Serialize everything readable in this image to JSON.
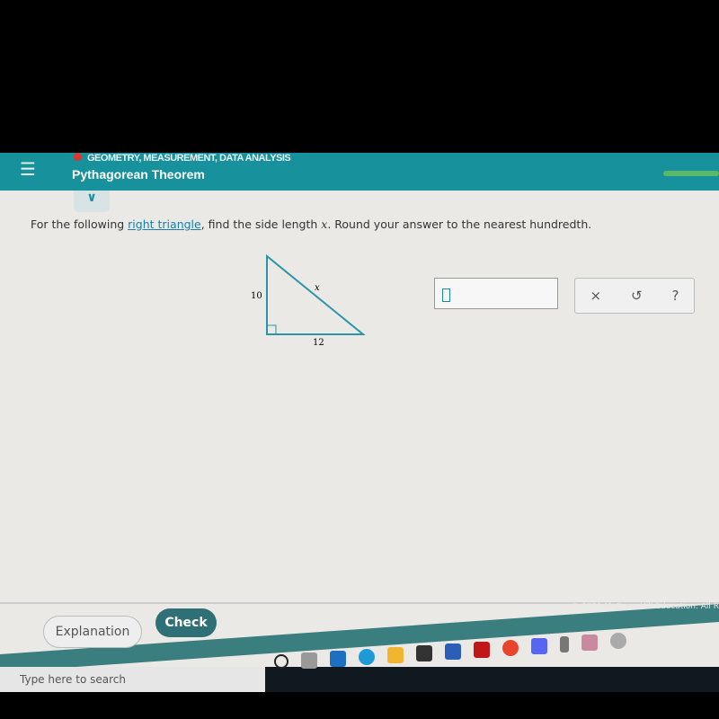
{
  "header": {
    "menu_icon": "hamburger-icon",
    "category": "GEOMETRY, MEASUREMENT, DATA ANALYSIS",
    "title": "Pythagorean Theorem",
    "status_color": "#e2342b",
    "accent": "#17919c"
  },
  "question": {
    "before": "For the following ",
    "link": "right triangle",
    "after": ", find the side length ",
    "var": "x",
    "end": ". Round your answer to the nearest hundredth."
  },
  "triangle": {
    "leg_vertical": "10",
    "leg_horizontal": "12",
    "hypotenuse": "x"
  },
  "answer": {
    "value": ""
  },
  "tools": {
    "clear": "×",
    "undo": "↺",
    "help": "?"
  },
  "footer": {
    "explanation": "Explanation",
    "check": "Check",
    "copyright": "© 2021 McGraw-Hill Education. All R"
  },
  "taskbar": {
    "search_placeholder": "Type here to search",
    "apps": [
      "cortana-icon",
      "task-view-icon",
      "mail-icon",
      "edge-icon",
      "file-explorer-icon",
      "store-icon",
      "word-icon",
      "netflix-icon",
      "chrome-icon",
      "discord-icon",
      "mouse-icon",
      "paint-icon",
      "app-icon"
    ]
  }
}
